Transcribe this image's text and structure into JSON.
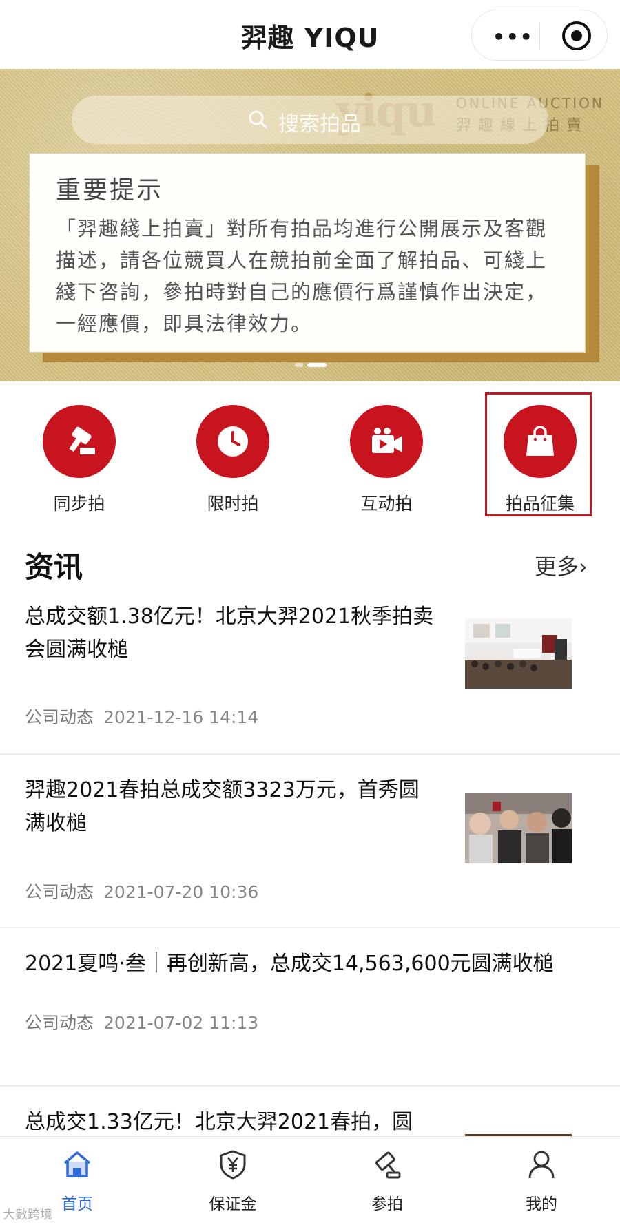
{
  "app": {
    "title": "羿趣 YIQU",
    "menu_icon": "more-dots-icon",
    "close_icon": "target-circle-icon"
  },
  "banner": {
    "search_placeholder": "搜索拍品",
    "brand_logo_text": "yiqu",
    "brand_en": "ONLINE AUCTION",
    "brand_cn": "羿趣線上拍賣",
    "notice_title": "重要提示",
    "notice_body": "「羿趣綫上拍賣」對所有拍品均進行公開展示及客觀描述，請各位競買人在競拍前全面了解拍品、可綫上綫下咨詢，參拍時對自己的應價行爲謹慎作出決定，一經應價，即具法律效力。",
    "active_slide": 2,
    "slide_count": 2
  },
  "categories": [
    {
      "label": "同步拍",
      "icon": "gavel-icon"
    },
    {
      "label": "限时拍",
      "icon": "clock-icon"
    },
    {
      "label": "互动拍",
      "icon": "video-camera-icon"
    },
    {
      "label": "拍品征集",
      "icon": "shopping-bag-icon"
    }
  ],
  "news": {
    "title": "资讯",
    "more_label": "更多",
    "items": [
      {
        "headline": "总成交额1.38亿元！北京大羿2021秋季拍卖会圆满收槌",
        "category": "公司动态",
        "date": "2021-12-16 14:14",
        "has_thumb": true
      },
      {
        "headline": "羿趣2021春拍总成交额3323万元，首秀圆满收槌",
        "category": "公司动态",
        "date": "2021-07-20 10:36",
        "has_thumb": true
      },
      {
        "headline": "2021夏鸣·叁｜再创新高，总成交14,563,600元圆满收槌",
        "category": "公司动态",
        "date": "2021-07-02 11:13",
        "has_thumb": false
      },
      {
        "headline": "总成交1.33亿元！北京大羿2021春拍，圆",
        "category": "",
        "date": "",
        "has_thumb": true
      }
    ]
  },
  "tabbar": [
    {
      "label": "首页",
      "icon": "home-icon",
      "active": true
    },
    {
      "label": "保证金",
      "icon": "yuan-shield-icon",
      "active": false
    },
    {
      "label": "参拍",
      "icon": "gavel-icon",
      "active": false
    },
    {
      "label": "我的",
      "icon": "user-icon",
      "active": false
    }
  ],
  "watermark": "大數跨境",
  "colors": {
    "brand_red": "#c8141f",
    "active_tab": "#2f6bd8",
    "banner_gold": "#d8c88f"
  }
}
